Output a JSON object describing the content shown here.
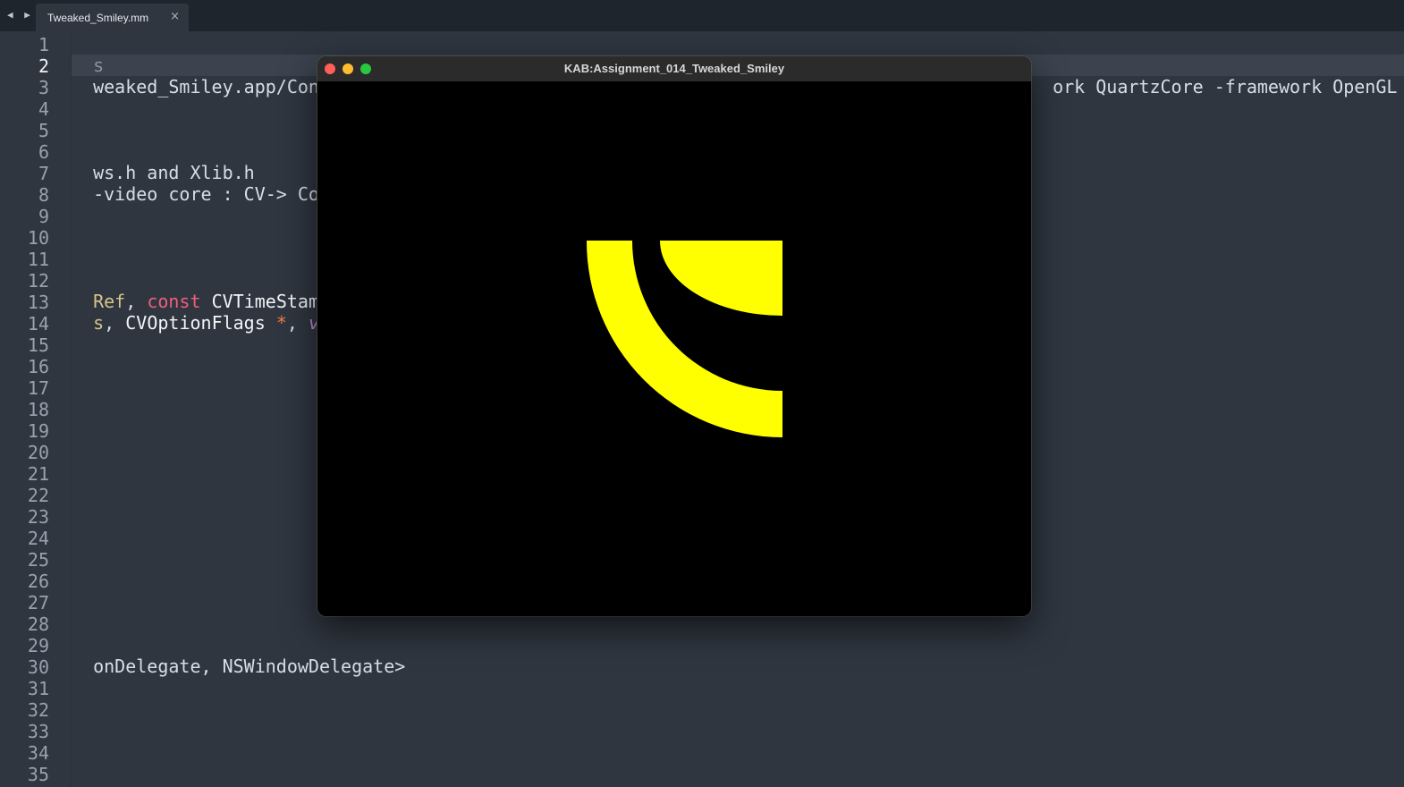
{
  "editor": {
    "tab_title": "Tweaked_Smiley.mm",
    "tab_close_glyph": "×",
    "nav_back_glyph": "◀",
    "nav_forward_glyph": "▶",
    "active_line": 2,
    "line_numbers": [
      "1",
      "2",
      "3",
      "4",
      "5",
      "6",
      "7",
      "8",
      "9",
      "10",
      "11",
      "12",
      "13",
      "14",
      "15",
      "16",
      "17",
      "18",
      "19",
      "20",
      "21",
      "22",
      "23",
      "24",
      "25",
      "26",
      "27",
      "28",
      "29",
      "30",
      "31",
      "32",
      "33",
      "34",
      "35"
    ],
    "visible_code": {
      "l1": "s",
      "l2_left": "weaked_Smiley.app/Conten",
      "l2_right": "ork QuartzCore -framework OpenGL",
      "l6": "ws.h and Xlib.h",
      "l7": "-video core : CV-> Core",
      "l12": {
        "a": "Ref",
        "b": ", ",
        "c": "const",
        "d": " ",
        "e": "CVTimeStamp",
        "f": " *"
      },
      "l13": {
        "a": "s",
        "b": ", ",
        "c": "CVOptionFlags",
        "d": " ",
        "e": "*",
        "f": ", ",
        "g": "void"
      },
      "l29": "onDelegate, NSWindowDelegate>"
    }
  },
  "app_window": {
    "title": "KAB:Assignment_014_Tweaked_Smiley",
    "canvas_background": "#000000",
    "shape_color": "#ffff00"
  }
}
